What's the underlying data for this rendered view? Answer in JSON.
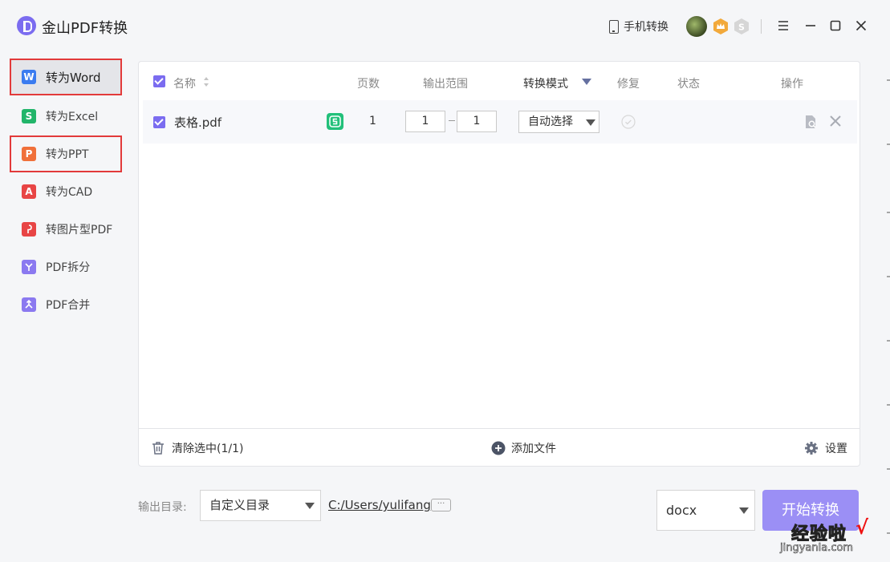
{
  "app": {
    "title": "金山PDF转换",
    "mobile_label": "手机转换"
  },
  "sidebar": {
    "items": [
      {
        "label": "转为Word",
        "icon": "W",
        "color": "#3b7cf0"
      },
      {
        "label": "转为Excel",
        "icon": "S",
        "color": "#22b56a"
      },
      {
        "label": "转为PPT",
        "icon": "P",
        "color": "#f0703a"
      },
      {
        "label": "转为CAD",
        "icon": "A",
        "color": "#e84545"
      },
      {
        "label": "转图片型PDF",
        "icon": "pdf",
        "color": "#e84545"
      },
      {
        "label": "PDF拆分",
        "icon": "split",
        "color": "#8b79f0"
      },
      {
        "label": "PDF合并",
        "icon": "merge",
        "color": "#8b79f0"
      }
    ]
  },
  "table": {
    "headers": {
      "name": "名称",
      "pages": "页数",
      "range": "输出范围",
      "mode": "转换模式",
      "repair": "修复",
      "status": "状态",
      "action": "操作"
    },
    "rows": [
      {
        "name": "表格.pdf",
        "pages": "1",
        "range_from": "1",
        "range_to": "1",
        "mode": "自动选择"
      }
    ]
  },
  "footer": {
    "clear": "清除选中(1/1)",
    "add": "添加文件",
    "settings": "设置"
  },
  "output": {
    "label": "输出目录:",
    "dir_option": "自定义目录",
    "path": "C:/Users/yulifang",
    "more": "···",
    "format": "docx",
    "start": "开始转换"
  },
  "watermark": {
    "text": "经验啦",
    "check": "√",
    "sub": "jingyanla.com"
  },
  "colors": {
    "accent": "#7b6cf0",
    "start_button": "#9b8ff5",
    "highlight_box": "#e23a3a"
  }
}
